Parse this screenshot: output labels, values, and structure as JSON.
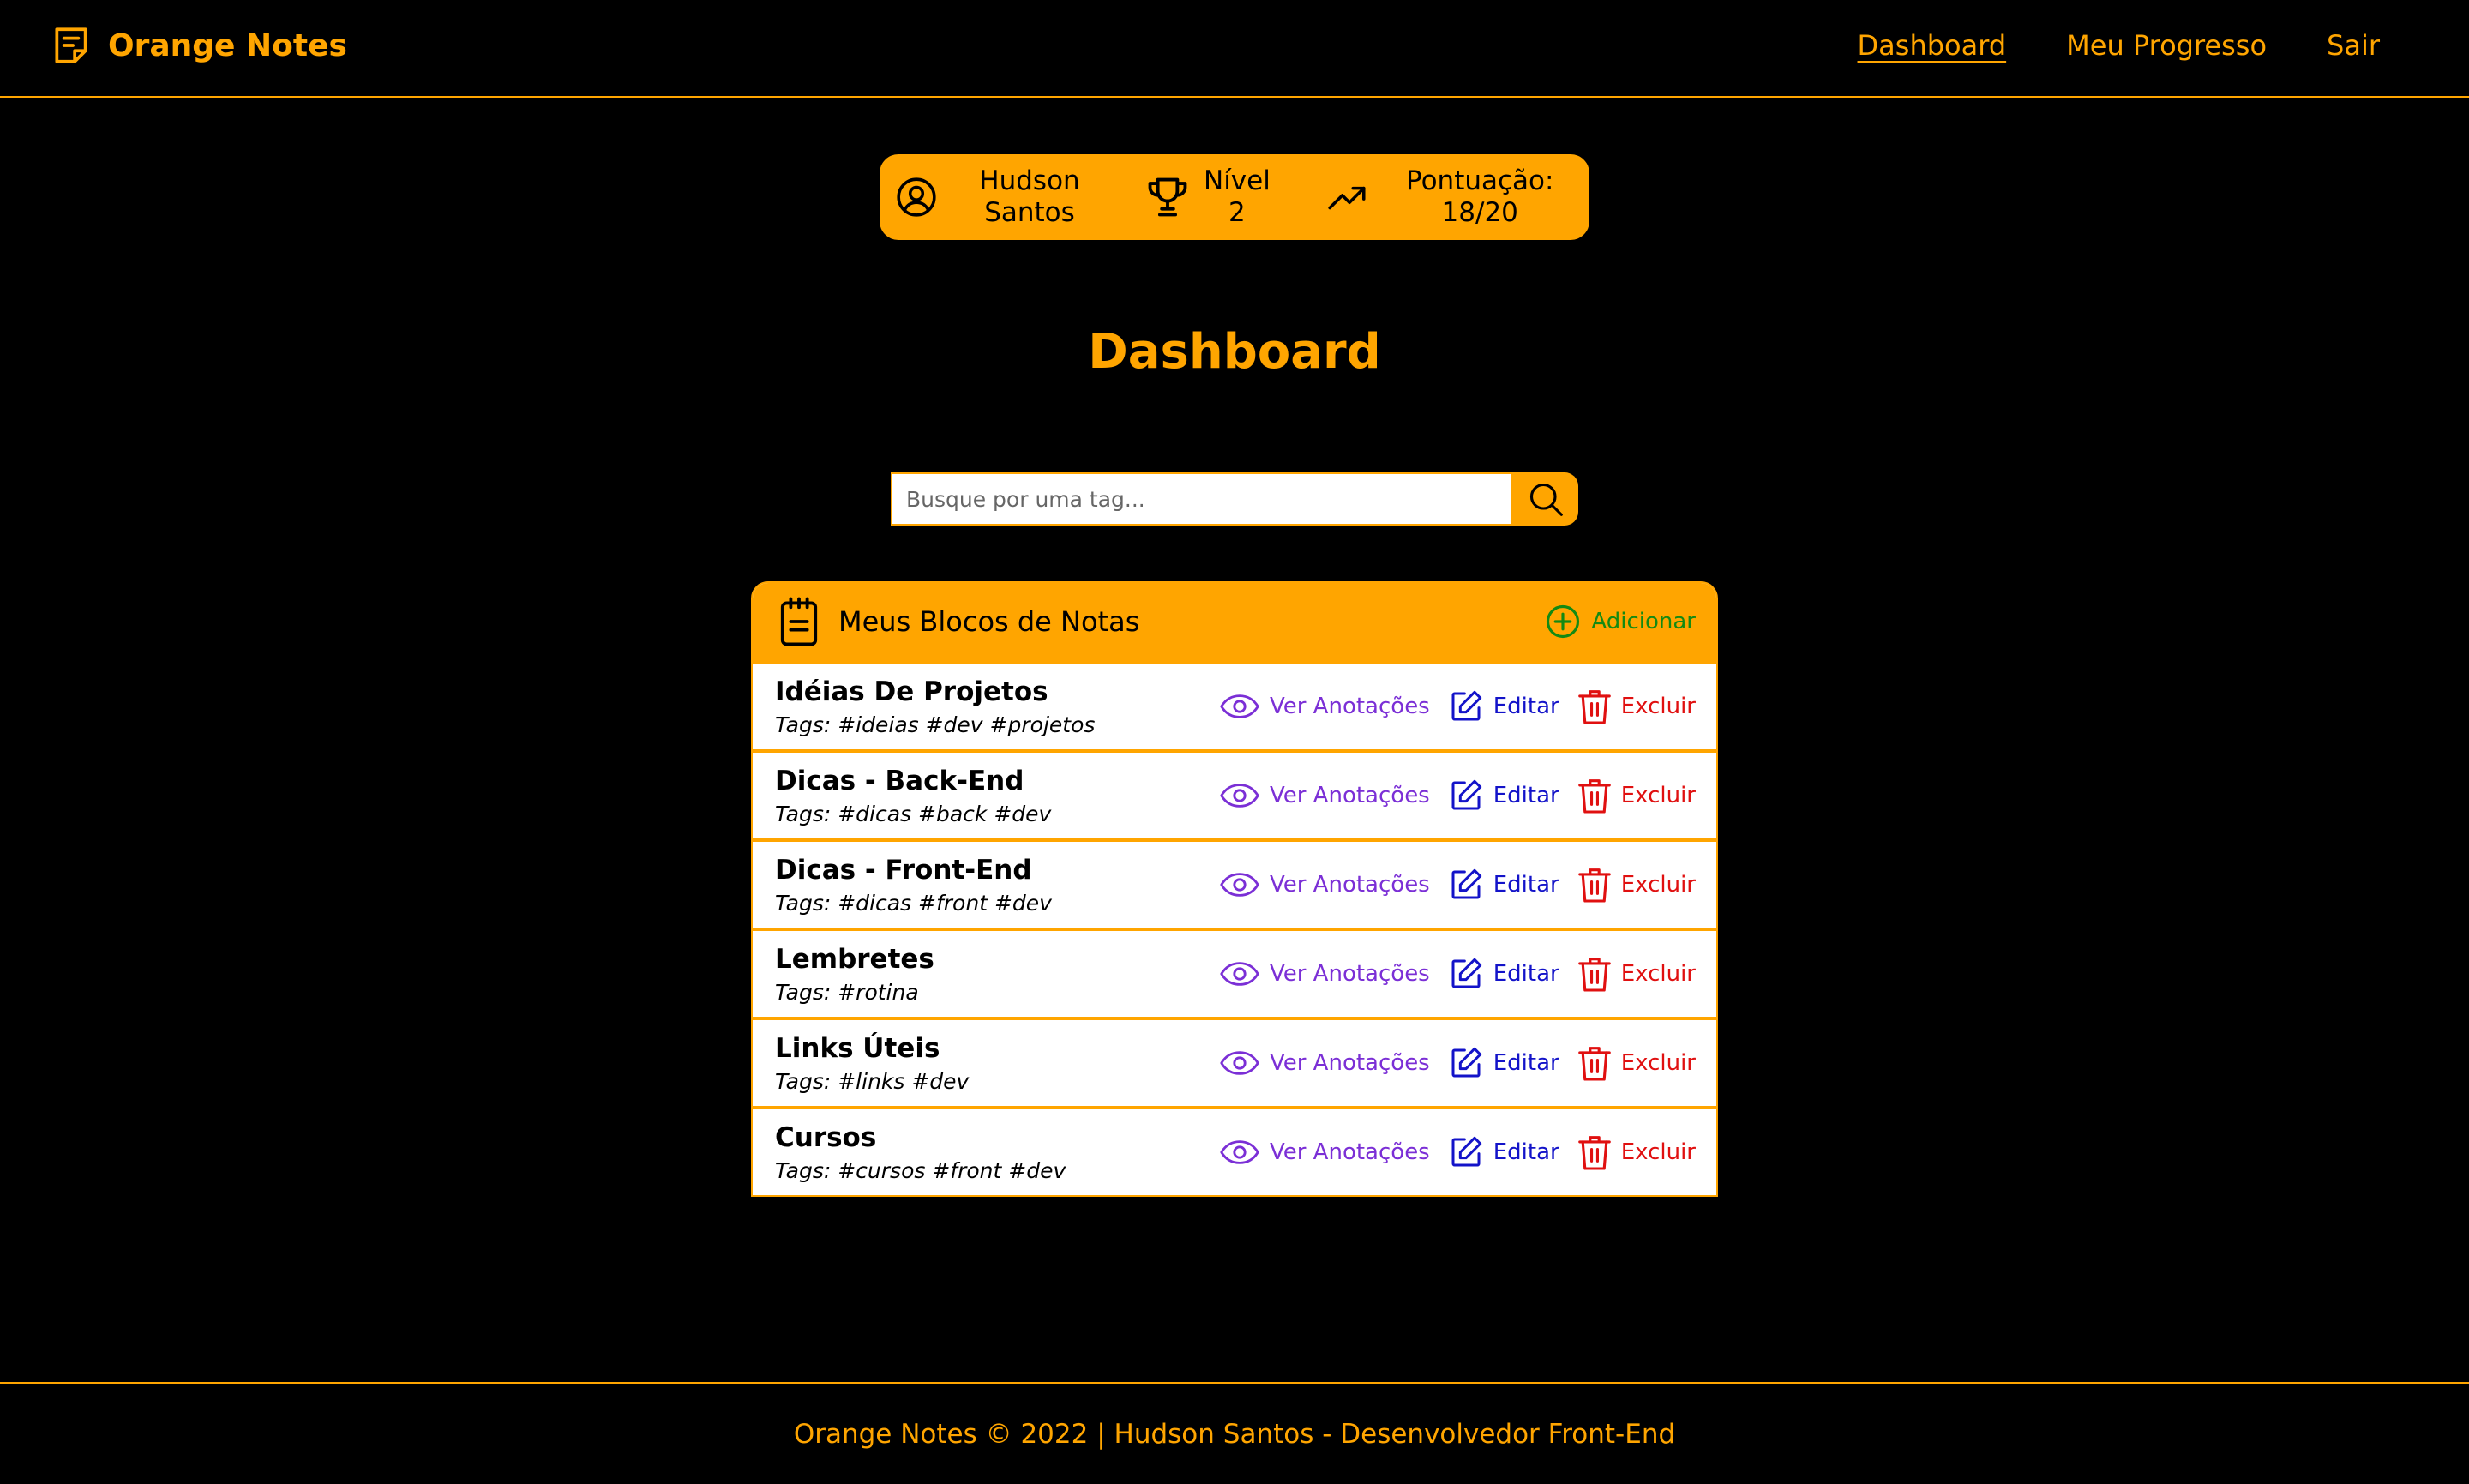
{
  "header": {
    "brand": "Orange Notes",
    "nav": [
      {
        "label": "Dashboard",
        "active": true
      },
      {
        "label": "Meu Progresso",
        "active": false
      },
      {
        "label": "Sair",
        "active": false
      }
    ]
  },
  "stats": {
    "user_first": "Hudson",
    "user_last": "Santos",
    "level_label": "Nível",
    "level_value": "2",
    "score_label": "Pontuação:",
    "score_value": "18/20"
  },
  "page_title": "Dashboard",
  "search": {
    "placeholder": "Busque por uma tag..."
  },
  "notebooks": {
    "title": "Meus Blocos de Notas",
    "add_label": "Adicionar",
    "view_label": "Ver Anotações",
    "edit_label": "Editar",
    "delete_label": "Excluir",
    "items": [
      {
        "name": "Idéias De Projetos",
        "tags": "Tags: #ideias #dev #projetos"
      },
      {
        "name": "Dicas - Back-End",
        "tags": "Tags: #dicas #back #dev"
      },
      {
        "name": "Dicas - Front-End",
        "tags": "Tags: #dicas #front #dev"
      },
      {
        "name": "Lembretes",
        "tags": "Tags: #rotina"
      },
      {
        "name": "Links Úteis",
        "tags": "Tags: #links #dev"
      },
      {
        "name": "Cursos",
        "tags": "Tags: #cursos #front #dev"
      }
    ]
  },
  "footer": {
    "text": "Orange Notes © 2022 | Hudson Santos - Desenvolvedor Front-End"
  },
  "colors": {
    "accent": "#ffa500",
    "background": "#000000",
    "view": "#7b2fd6",
    "edit": "#1313c9",
    "delete": "#e01010",
    "add": "#138a13"
  },
  "icons": {
    "brand": "note-icon",
    "user": "user-circle-icon",
    "level": "trophy-icon",
    "score": "trending-up-icon",
    "search": "search-icon",
    "panel": "notepad-icon",
    "add": "plus-circle-icon",
    "view": "eye-icon",
    "edit": "edit-icon",
    "delete": "trash-icon"
  }
}
